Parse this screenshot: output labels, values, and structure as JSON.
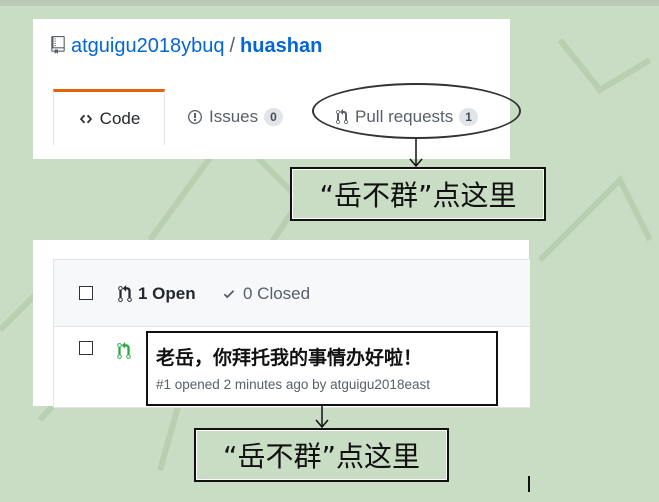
{
  "repo": {
    "owner": "atguigu2018ybuq",
    "separator": "/",
    "name": "huashan"
  },
  "tabs": [
    {
      "label": "Code",
      "icon": "code-icon"
    },
    {
      "label": "Issues",
      "count": "0",
      "icon": "issue-opened-icon"
    },
    {
      "label": "Pull requests",
      "count": "1",
      "icon": "git-pull-request-icon"
    }
  ],
  "callouts": {
    "first": "“岳不群”点这里",
    "second": "“岳不群”点这里"
  },
  "pr_list": {
    "open_label": "1 Open",
    "closed_label": "0 Closed",
    "items": [
      {
        "title": "老岳，你拜托我的事情办好啦！",
        "meta": "#1 opened 2 minutes ago by atguigu2018east"
      }
    ]
  },
  "colors": {
    "accent": "#e36209",
    "link": "#0366d6",
    "open_green": "#28a745",
    "background": "#c9ddc4"
  }
}
